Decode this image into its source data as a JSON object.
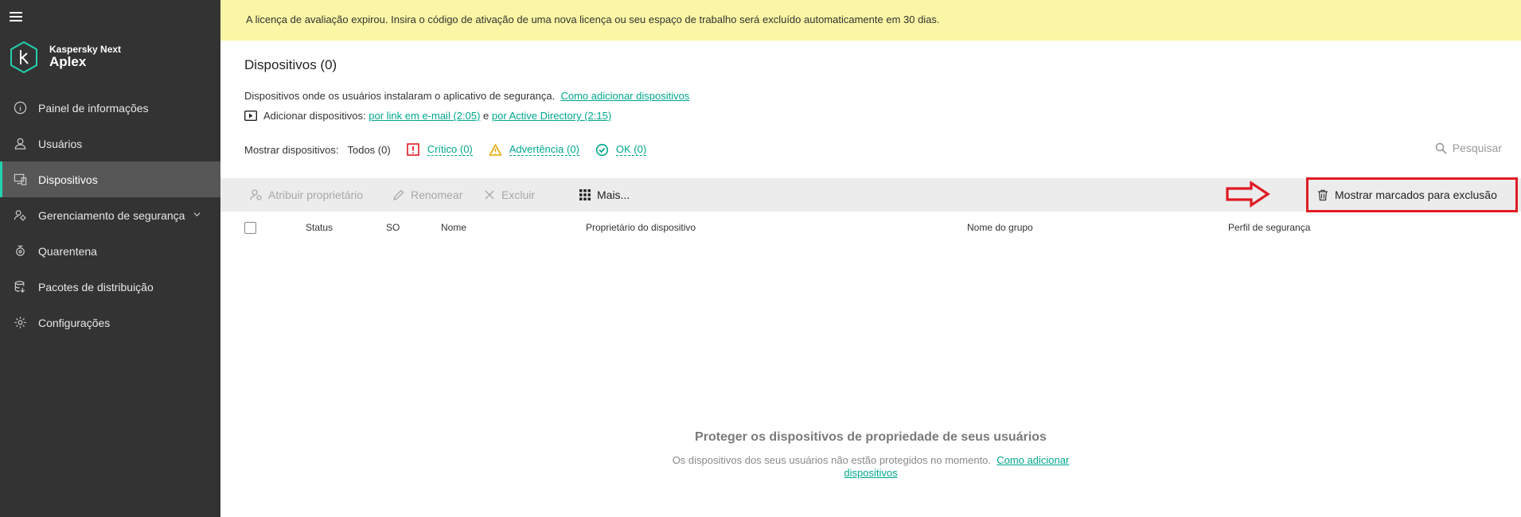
{
  "app": {
    "brand_line1": "Kaspersky Next",
    "brand_line2": "Aplex"
  },
  "sidebar": {
    "items": [
      {
        "label": "Painel de informações",
        "icon": "info-icon"
      },
      {
        "label": "Usuários",
        "icon": "user-icon"
      },
      {
        "label": "Dispositivos",
        "icon": "devices-icon",
        "active": true
      },
      {
        "label": "Gerenciamento de segurança",
        "icon": "security-management-icon",
        "has_submenu": true
      },
      {
        "label": "Quarentena",
        "icon": "quarantine-icon"
      },
      {
        "label": "Pacotes de distribuição",
        "icon": "packages-icon"
      },
      {
        "label": "Configurações",
        "icon": "gear-icon"
      }
    ]
  },
  "banner": {
    "text": "A licença de avaliação expirou. Insira o código de ativação de uma nova licença ou seu espaço de trabalho será excluído automaticamente em 30 dias."
  },
  "page": {
    "title": "Dispositivos (0)",
    "description": "Dispositivos onde os usuários instalaram o aplicativo de segurança.",
    "description_link": "Como adicionar dispositivos",
    "add_prefix": "Adicionar dispositivos:",
    "add_link_email": "por link em e-mail (2:05)",
    "add_and": "e",
    "add_link_ad": "por Active Directory (2:15)"
  },
  "filters": {
    "label": "Mostrar dispositivos:",
    "all": "Todos (0)",
    "critical": "Crítico (0)",
    "warning": "Advertência (0)",
    "ok": "OK (0)"
  },
  "search": {
    "label": "Pesquisar"
  },
  "toolbar": {
    "assign_owner": "Atribuir proprietário",
    "rename": "Renomear",
    "delete": "Excluir",
    "more": "Mais...",
    "show_marked": "Mostrar marcados para exclusão"
  },
  "table": {
    "columns": [
      "Status",
      "SO",
      "Nome",
      "Proprietário do dispositivo",
      "Nome do grupo",
      "Perfil de segurança"
    ]
  },
  "empty_state": {
    "title": "Proteger os dispositivos de propriedade de seus usuários",
    "text": "Os dispositivos dos seus usuários não estão protegidos no momento.",
    "link": "Como adicionar dispositivos"
  },
  "colors": {
    "accent": "#00a88e",
    "sidebar_bg": "#333333",
    "banner_bg": "#fbf6a5",
    "highlight": "#e01b24"
  }
}
